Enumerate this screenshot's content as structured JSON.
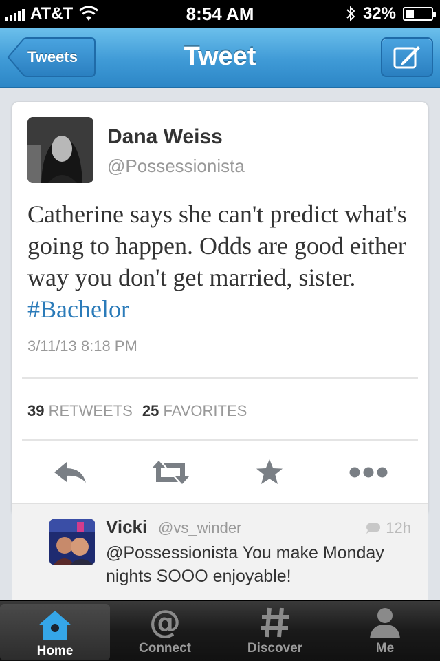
{
  "status_bar": {
    "carrier": "AT&T",
    "time": "8:54 AM",
    "battery_percent": "32%",
    "battery_level": 0.32
  },
  "nav": {
    "back_label": "Tweets",
    "title": "Tweet",
    "compose_icon": "compose-icon"
  },
  "tweet": {
    "author_name": "Dana Weiss",
    "author_handle": "@Possessionista",
    "text": "Catherine says she can't predict what's going to happen. Odds are good either way you don't get married, sister.",
    "hashtag": "#Bachelor",
    "date": "3/11/13 8:18 PM",
    "retweets_count": "39",
    "retweets_label": "RETWEETS",
    "favorites_count": "25",
    "favorites_label": "FAVORITES",
    "actions": [
      "reply-icon",
      "retweet-icon",
      "favorite-star-icon",
      "more-dots-icon"
    ]
  },
  "reply": {
    "name": "Vicki",
    "handle": "@vs_winder",
    "time": "12h",
    "text": "@Possessionista You make Monday nights SOOO enjoyable!"
  },
  "tab_bar": {
    "tabs": [
      {
        "label": "Home",
        "icon": "home-icon",
        "active": true
      },
      {
        "label": "Connect",
        "icon": "at-icon",
        "active": false
      },
      {
        "label": "Discover",
        "icon": "hash-icon",
        "active": false
      },
      {
        "label": "Me",
        "icon": "person-icon",
        "active": false
      }
    ]
  },
  "colors": {
    "nav_blue": "#3f9ad6",
    "hashtag_blue": "#2b7bb9",
    "home_icon_blue": "#35a6e8"
  }
}
